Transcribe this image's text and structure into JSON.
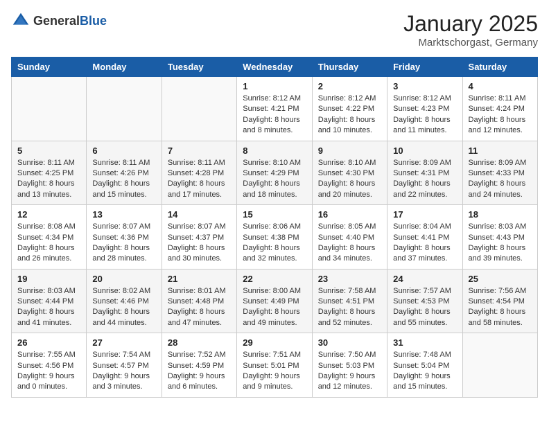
{
  "header": {
    "logo_general": "General",
    "logo_blue": "Blue",
    "title": "January 2025",
    "subtitle": "Marktschorgast, Germany"
  },
  "calendar": {
    "days_of_week": [
      "Sunday",
      "Monday",
      "Tuesday",
      "Wednesday",
      "Thursday",
      "Friday",
      "Saturday"
    ],
    "weeks": [
      [
        {
          "day": "",
          "info": ""
        },
        {
          "day": "",
          "info": ""
        },
        {
          "day": "",
          "info": ""
        },
        {
          "day": "1",
          "info": "Sunrise: 8:12 AM\nSunset: 4:21 PM\nDaylight: 8 hours\nand 8 minutes."
        },
        {
          "day": "2",
          "info": "Sunrise: 8:12 AM\nSunset: 4:22 PM\nDaylight: 8 hours\nand 10 minutes."
        },
        {
          "day": "3",
          "info": "Sunrise: 8:12 AM\nSunset: 4:23 PM\nDaylight: 8 hours\nand 11 minutes."
        },
        {
          "day": "4",
          "info": "Sunrise: 8:11 AM\nSunset: 4:24 PM\nDaylight: 8 hours\nand 12 minutes."
        }
      ],
      [
        {
          "day": "5",
          "info": "Sunrise: 8:11 AM\nSunset: 4:25 PM\nDaylight: 8 hours\nand 13 minutes."
        },
        {
          "day": "6",
          "info": "Sunrise: 8:11 AM\nSunset: 4:26 PM\nDaylight: 8 hours\nand 15 minutes."
        },
        {
          "day": "7",
          "info": "Sunrise: 8:11 AM\nSunset: 4:28 PM\nDaylight: 8 hours\nand 17 minutes."
        },
        {
          "day": "8",
          "info": "Sunrise: 8:10 AM\nSunset: 4:29 PM\nDaylight: 8 hours\nand 18 minutes."
        },
        {
          "day": "9",
          "info": "Sunrise: 8:10 AM\nSunset: 4:30 PM\nDaylight: 8 hours\nand 20 minutes."
        },
        {
          "day": "10",
          "info": "Sunrise: 8:09 AM\nSunset: 4:31 PM\nDaylight: 8 hours\nand 22 minutes."
        },
        {
          "day": "11",
          "info": "Sunrise: 8:09 AM\nSunset: 4:33 PM\nDaylight: 8 hours\nand 24 minutes."
        }
      ],
      [
        {
          "day": "12",
          "info": "Sunrise: 8:08 AM\nSunset: 4:34 PM\nDaylight: 8 hours\nand 26 minutes."
        },
        {
          "day": "13",
          "info": "Sunrise: 8:07 AM\nSunset: 4:36 PM\nDaylight: 8 hours\nand 28 minutes."
        },
        {
          "day": "14",
          "info": "Sunrise: 8:07 AM\nSunset: 4:37 PM\nDaylight: 8 hours\nand 30 minutes."
        },
        {
          "day": "15",
          "info": "Sunrise: 8:06 AM\nSunset: 4:38 PM\nDaylight: 8 hours\nand 32 minutes."
        },
        {
          "day": "16",
          "info": "Sunrise: 8:05 AM\nSunset: 4:40 PM\nDaylight: 8 hours\nand 34 minutes."
        },
        {
          "day": "17",
          "info": "Sunrise: 8:04 AM\nSunset: 4:41 PM\nDaylight: 8 hours\nand 37 minutes."
        },
        {
          "day": "18",
          "info": "Sunrise: 8:03 AM\nSunset: 4:43 PM\nDaylight: 8 hours\nand 39 minutes."
        }
      ],
      [
        {
          "day": "19",
          "info": "Sunrise: 8:03 AM\nSunset: 4:44 PM\nDaylight: 8 hours\nand 41 minutes."
        },
        {
          "day": "20",
          "info": "Sunrise: 8:02 AM\nSunset: 4:46 PM\nDaylight: 8 hours\nand 44 minutes."
        },
        {
          "day": "21",
          "info": "Sunrise: 8:01 AM\nSunset: 4:48 PM\nDaylight: 8 hours\nand 47 minutes."
        },
        {
          "day": "22",
          "info": "Sunrise: 8:00 AM\nSunset: 4:49 PM\nDaylight: 8 hours\nand 49 minutes."
        },
        {
          "day": "23",
          "info": "Sunrise: 7:58 AM\nSunset: 4:51 PM\nDaylight: 8 hours\nand 52 minutes."
        },
        {
          "day": "24",
          "info": "Sunrise: 7:57 AM\nSunset: 4:53 PM\nDaylight: 8 hours\nand 55 minutes."
        },
        {
          "day": "25",
          "info": "Sunrise: 7:56 AM\nSunset: 4:54 PM\nDaylight: 8 hours\nand 58 minutes."
        }
      ],
      [
        {
          "day": "26",
          "info": "Sunrise: 7:55 AM\nSunset: 4:56 PM\nDaylight: 9 hours\nand 0 minutes."
        },
        {
          "day": "27",
          "info": "Sunrise: 7:54 AM\nSunset: 4:57 PM\nDaylight: 9 hours\nand 3 minutes."
        },
        {
          "day": "28",
          "info": "Sunrise: 7:52 AM\nSunset: 4:59 PM\nDaylight: 9 hours\nand 6 minutes."
        },
        {
          "day": "29",
          "info": "Sunrise: 7:51 AM\nSunset: 5:01 PM\nDaylight: 9 hours\nand 9 minutes."
        },
        {
          "day": "30",
          "info": "Sunrise: 7:50 AM\nSunset: 5:03 PM\nDaylight: 9 hours\nand 12 minutes."
        },
        {
          "day": "31",
          "info": "Sunrise: 7:48 AM\nSunset: 5:04 PM\nDaylight: 9 hours\nand 15 minutes."
        },
        {
          "day": "",
          "info": ""
        }
      ]
    ]
  }
}
